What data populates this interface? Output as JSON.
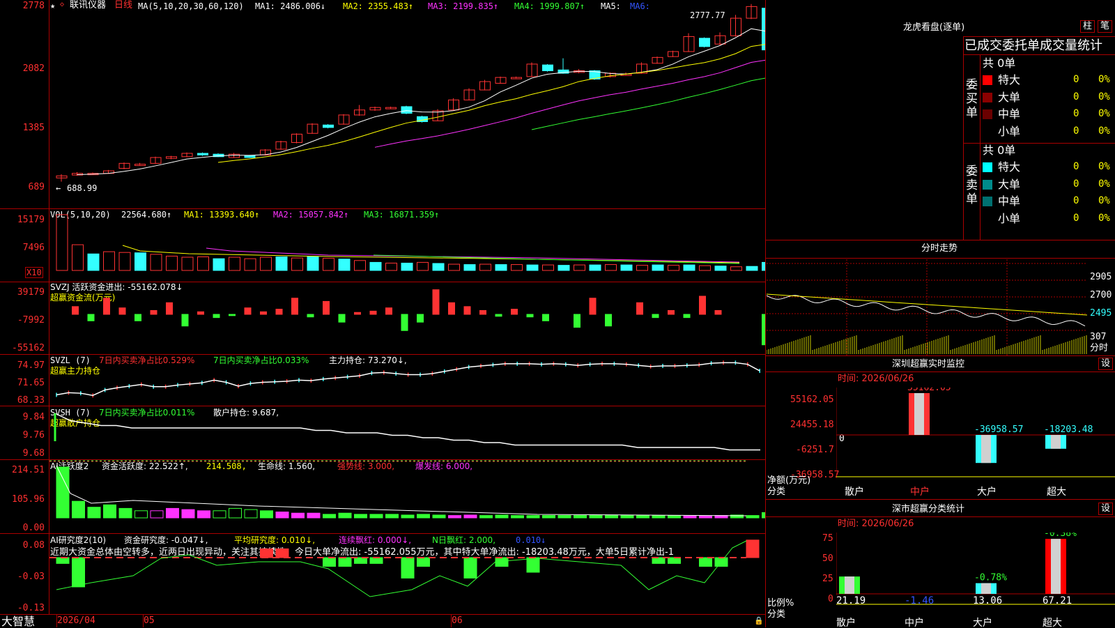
{
  "colors": {
    "up": "#ff3333",
    "down": "#33ffff",
    "grid": "#aa0000",
    "bg": "#000000",
    "ma1": "#ffffff",
    "ma2": "#ffff00",
    "ma3": "#ff33ff",
    "ma4": "#33ff33",
    "ma5": "#3355ff"
  },
  "main_panel": {
    "star": "★",
    "name": "联讯仪器",
    "period": "日线",
    "ma_label": "MA(5,10,20,30,60,120)",
    "ma1": "MA1: 2486.006↓",
    "ma2": "MA2: 2355.483↑",
    "ma3": "MA3: 2199.835↑",
    "ma4": "MA4: 1999.807↑",
    "ma5": "MA5:",
    "ma6": "MA6:",
    "high_mark": "2777.77",
    "low_mark": "688.99",
    "axis": [
      "2778",
      "2082",
      "1385",
      "689"
    ]
  },
  "vol_panel": {
    "label": "VOL(5,10,20)",
    "value": "22564.680↑",
    "ma1": "MA1: 13393.640↑",
    "ma2": "MA2: 15057.842↑",
    "ma3": "MA3: 16871.359↑",
    "axis": [
      "15179",
      "7496"
    ],
    "unit": "X10"
  },
  "svzj_panel": {
    "label": "SVZJ  活跃资金进出: -55162.078↓",
    "sub": "超赢资金流(万元)",
    "axis": [
      "39179",
      "-7992",
      "-55162"
    ]
  },
  "svzl_panel": {
    "label": "SVZL (7)",
    "l1": "7日内买卖净占比0.529%",
    "l2": "7日内买卖净占比0.033%",
    "l3": "主力持仓: 73.270↓,",
    "sub": "超赢主力持仓",
    "axis": [
      "74.97",
      "71.65",
      "68.33"
    ]
  },
  "svsh_panel": {
    "label": "SVSH (7)",
    "l1": "7日内买卖净占比0.011%",
    "l2": "散户持仓: 9.687,",
    "sub": "超赢散户持仓",
    "axis": [
      "9.84",
      "9.76",
      "9.68"
    ]
  },
  "ai1_panel": {
    "label": "AI活跃度2",
    "l1": "资金活跃度: 22.522↑,",
    "l2": "214.508,",
    "l3": "生命线: 1.560,",
    "l4": "强势线: 3.000,",
    "l5": "爆发线: 6.000,",
    "axis": [
      "214.51",
      "105.96",
      "0.00"
    ]
  },
  "ai2_panel": {
    "label": "AI研究度2(10)",
    "l1": "资金研究度: -0.047↓,",
    "l2": "平均研究度: 0.010↓,",
    "l3": "连续飘红: 0.000↓,",
    "l4": "N日飘红: 2.000,",
    "l5": "0.010↓",
    "text": "近期大资金总体由空转多，近两日出现异动，关注其持续性，今日大单净流出: -55162.055万元，其中特大单净流出: -18203.48万元，大单5日累计净出-1",
    "axis": [
      "0.08",
      "-0.03",
      "-0.13"
    ]
  },
  "bottom": {
    "brand": "大智慧",
    "dates": [
      "2026/04",
      "05",
      "06"
    ]
  },
  "right": {
    "title": "龙虎看盘(逐单)",
    "btn1": "柱",
    "btn2": "笔",
    "tabs": "已成交委托单成交量统计",
    "buy": {
      "side": "委买单",
      "count": "共 0单",
      "rows": [
        {
          "label": "特大",
          "v": "0",
          "p": "0%",
          "c": "#ff0000"
        },
        {
          "label": "大单",
          "v": "0",
          "p": "0%",
          "c": "#8b0000"
        },
        {
          "label": "中单",
          "v": "0",
          "p": "0%",
          "c": "#6a0000"
        },
        {
          "label": "小单",
          "v": "0",
          "p": "0%",
          "c": ""
        }
      ]
    },
    "sell": {
      "side": "委卖单",
      "count": "共 0单",
      "rows": [
        {
          "label": "特大",
          "v": "0",
          "p": "0%",
          "c": "#00ffff"
        },
        {
          "label": "大单",
          "v": "0",
          "p": "0%",
          "c": "#008b8b"
        },
        {
          "label": "中单",
          "v": "0",
          "p": "0%",
          "c": "#007070"
        },
        {
          "label": "小单",
          "v": "0",
          "p": "0%",
          "c": ""
        }
      ]
    },
    "trend": {
      "title": "分时走势",
      "axis": [
        "2905",
        "2700",
        "2495",
        "307"
      ],
      "unit": "分时"
    },
    "monitor": {
      "title": "深圳超赢实时监控",
      "btn": "设",
      "time": "时间: 2026/06/26",
      "axis": [
        "55162.05",
        "24455.18",
        "-6251.7",
        "-36958.57"
      ],
      "zero": "0",
      "ylabel": "净额(万元)",
      "xlabel": "分类",
      "cats": [
        "散户",
        "中户",
        "大户",
        "超大"
      ],
      "labels": [
        "",
        "55162.05",
        "-36958.57",
        "-18203.48"
      ]
    },
    "stats": {
      "title": "深市超赢分类统计",
      "btn": "设",
      "time": "时间: 2026/06/26",
      "axis": [
        "75",
        "50",
        "25",
        "0"
      ],
      "ylabel": "比例%",
      "xlabel": "分类",
      "cats": [
        "散户",
        "中户",
        "大户",
        "超大"
      ],
      "top": [
        "",
        "",
        "-0.78%",
        "-0.38%"
      ],
      "bottom": [
        "21.19",
        "-1.46",
        "13.06",
        "67.21"
      ]
    }
  },
  "chart_data": [
    {
      "type": "candlestick",
      "title": "联讯仪器 日线",
      "ylim": [
        689,
        2778
      ],
      "candles": [
        [
          745,
          770,
          700,
          790
        ],
        [
          780,
          800,
          770,
          815
        ],
        [
          800,
          800,
          790,
          810
        ],
        [
          800,
          830,
          795,
          840
        ],
        [
          860,
          920,
          850,
          930
        ],
        [
          910,
          910,
          900,
          925
        ],
        [
          920,
          990,
          915,
          1000
        ],
        [
          980,
          1000,
          970,
          1010
        ],
        [
          1000,
          1040,
          995,
          1050
        ],
        [
          1040,
          1020,
          1010,
          1050
        ],
        [
          1030,
          1000,
          995,
          1040
        ],
        [
          990,
          1030,
          985,
          1045
        ],
        [
          1010,
          990,
          985,
          1020
        ],
        [
          1020,
          1080,
          1015,
          1090
        ],
        [
          1090,
          1180,
          1085,
          1190
        ],
        [
          1170,
          1270,
          1160,
          1280
        ],
        [
          1280,
          1390,
          1275,
          1400
        ],
        [
          1380,
          1350,
          1340,
          1390
        ],
        [
          1390,
          1500,
          1385,
          1510
        ],
        [
          1500,
          1560,
          1490,
          1620
        ],
        [
          1560,
          1590,
          1550,
          1600
        ],
        [
          1580,
          1590,
          1575,
          1600
        ],
        [
          1600,
          1520,
          1510,
          1610
        ],
        [
          1480,
          1420,
          1410,
          1490
        ],
        [
          1430,
          1550,
          1425,
          1570
        ],
        [
          1560,
          1680,
          1555,
          1700
        ],
        [
          1680,
          1800,
          1675,
          1820
        ],
        [
          1800,
          1900,
          1795,
          1920
        ],
        [
          1880,
          1950,
          1875,
          1960
        ],
        [
          1950,
          1950,
          1940,
          1960
        ],
        [
          1960,
          2110,
          1955,
          2130
        ],
        [
          2100,
          2030,
          2020,
          2110
        ],
        [
          2040,
          2000,
          1995,
          2180
        ],
        [
          2010,
          2030,
          2000,
          2050
        ],
        [
          2030,
          1930,
          1920,
          2040
        ],
        [
          1960,
          2000,
          1950,
          2010
        ],
        [
          1990,
          1990,
          1980,
          2010
        ],
        [
          2000,
          2110,
          1995,
          2130
        ],
        [
          2120,
          2190,
          2115,
          2200
        ],
        [
          2200,
          2260,
          2195,
          2270
        ],
        [
          2260,
          2440,
          2255,
          2480
        ],
        [
          2420,
          2320,
          2310,
          2430
        ],
        [
          2350,
          2450,
          2340,
          2490
        ],
        [
          2450,
          2660,
          2440,
          2700
        ],
        [
          2660,
          2800,
          2650,
          2830
        ],
        [
          2780,
          2280,
          2270,
          2800
        ]
      ],
      "ma": {
        "MA1": 2486.006,
        "MA2": 2355.483,
        "MA3": 2199.835,
        "MA4": 1999.807
      }
    },
    {
      "type": "bar",
      "title": "VOL",
      "values": [
        15179,
        7000,
        4500,
        5100,
        4900,
        4800,
        4400,
        3900,
        3600,
        3700,
        3200,
        3600,
        3200,
        3600,
        3700,
        3400,
        3800,
        3300,
        3100,
        2700,
        2200,
        2000,
        2000,
        2200,
        1900,
        1700,
        1600,
        1700,
        1600,
        1600,
        1500,
        1500,
        1400,
        1500,
        1500,
        1600,
        1500,
        1400,
        1500,
        1400,
        1500,
        1300,
        1200,
        1000,
        1100,
        2200
      ]
    },
    {
      "type": "bar",
      "title": "SVZJ",
      "values": [
        0,
        12000,
        -10000,
        25000,
        10000,
        -10000,
        6000,
        18000,
        -18000,
        4000,
        -5000,
        -2000,
        10000,
        4000,
        8000,
        25000,
        -4000,
        20000,
        -12000,
        3000,
        5000,
        10000,
        -25000,
        -12000,
        38000,
        18000,
        12000,
        6000,
        -3000,
        8000,
        -4000,
        -10000,
        0,
        -20000,
        25000,
        -18000,
        0,
        18000,
        -5000,
        6000,
        -5000,
        28000,
        6000,
        0,
        0,
        -47000
      ]
    },
    {
      "type": "line",
      "title": "SVZL",
      "values": [
        68.9,
        69.3,
        69.2,
        68.8,
        69.8,
        70.2,
        70.5,
        70.8,
        70.4,
        70.4,
        70.7,
        70.9,
        71.1,
        71.6,
        71.2,
        70.5,
        71.0,
        71.2,
        71.3,
        71.4,
        71.6,
        71.5,
        71.8,
        72.0,
        72.2,
        72.4,
        72.9,
        73.0,
        72.8,
        72.6,
        72.6,
        72.8,
        73.2,
        73.6,
        74.0,
        74.2,
        74.4,
        74.6,
        74.6,
        74.6,
        74.5,
        74.6,
        74.5,
        74.3,
        74.5,
        74.6,
        74.6,
        74.5,
        74.3,
        74.1,
        74.2,
        74.2,
        74.3,
        74.4,
        74.7,
        74.8,
        74.8,
        74.5,
        73.3
      ]
    },
    {
      "type": "line",
      "title": "SVSH",
      "values": [
        9.84,
        9.81,
        9.8,
        9.79,
        9.79,
        9.78,
        9.78,
        9.78,
        9.78,
        9.78,
        9.78,
        9.78,
        9.78,
        9.78,
        9.78,
        9.78,
        9.78,
        9.77,
        9.77,
        9.76,
        9.76,
        9.76,
        9.75,
        9.75,
        9.74,
        9.74,
        9.73,
        9.73,
        9.72,
        9.72,
        9.71,
        9.71,
        9.71,
        9.71,
        9.71,
        9.71,
        9.71,
        9.71,
        9.7,
        9.7,
        9.7,
        9.7,
        9.7,
        9.7,
        9.69,
        9.69,
        9.69
      ]
    },
    {
      "type": "bar",
      "title": "AI活跃度2",
      "values": [
        214.5,
        70,
        45,
        55,
        40,
        30,
        30,
        40,
        35,
        30,
        30,
        40,
        35,
        30,
        25,
        20,
        20,
        15,
        20,
        15,
        15,
        15,
        12,
        15,
        12,
        10,
        12,
        10,
        12,
        10,
        10,
        10,
        10,
        10,
        10,
        12,
        10,
        10,
        10,
        10,
        8,
        8,
        10,
        12,
        10,
        22.5
      ]
    },
    {
      "type": "bar",
      "title": "AI研究度2",
      "values": [
        -0.02,
        -0.1,
        0,
        0,
        0,
        0,
        0,
        0,
        0,
        0,
        0,
        0,
        0,
        0.03,
        0.03,
        0,
        0,
        -0.03,
        -0.03,
        -0.02,
        -0.02,
        0,
        -0.07,
        -0.03,
        0,
        0,
        -0.07,
        0,
        -0.03,
        0,
        -0.05,
        0,
        0,
        0,
        0,
        0,
        0,
        0,
        -0.02,
        -0.02,
        0,
        -0.03,
        -0.03,
        0,
        0.06,
        0,
        -0.06
      ]
    },
    {
      "type": "bar",
      "title": "深圳超赢实时监控",
      "categories": [
        "散户",
        "中户",
        "大户",
        "超大"
      ],
      "values": [
        0,
        55162.05,
        -36958.57,
        -18203.48
      ]
    },
    {
      "type": "bar",
      "title": "深市超赢分类统计",
      "categories": [
        "散户",
        "中户",
        "大户",
        "超大"
      ],
      "values": [
        21.19,
        -1.46,
        13.06,
        67.21
      ]
    }
  ]
}
